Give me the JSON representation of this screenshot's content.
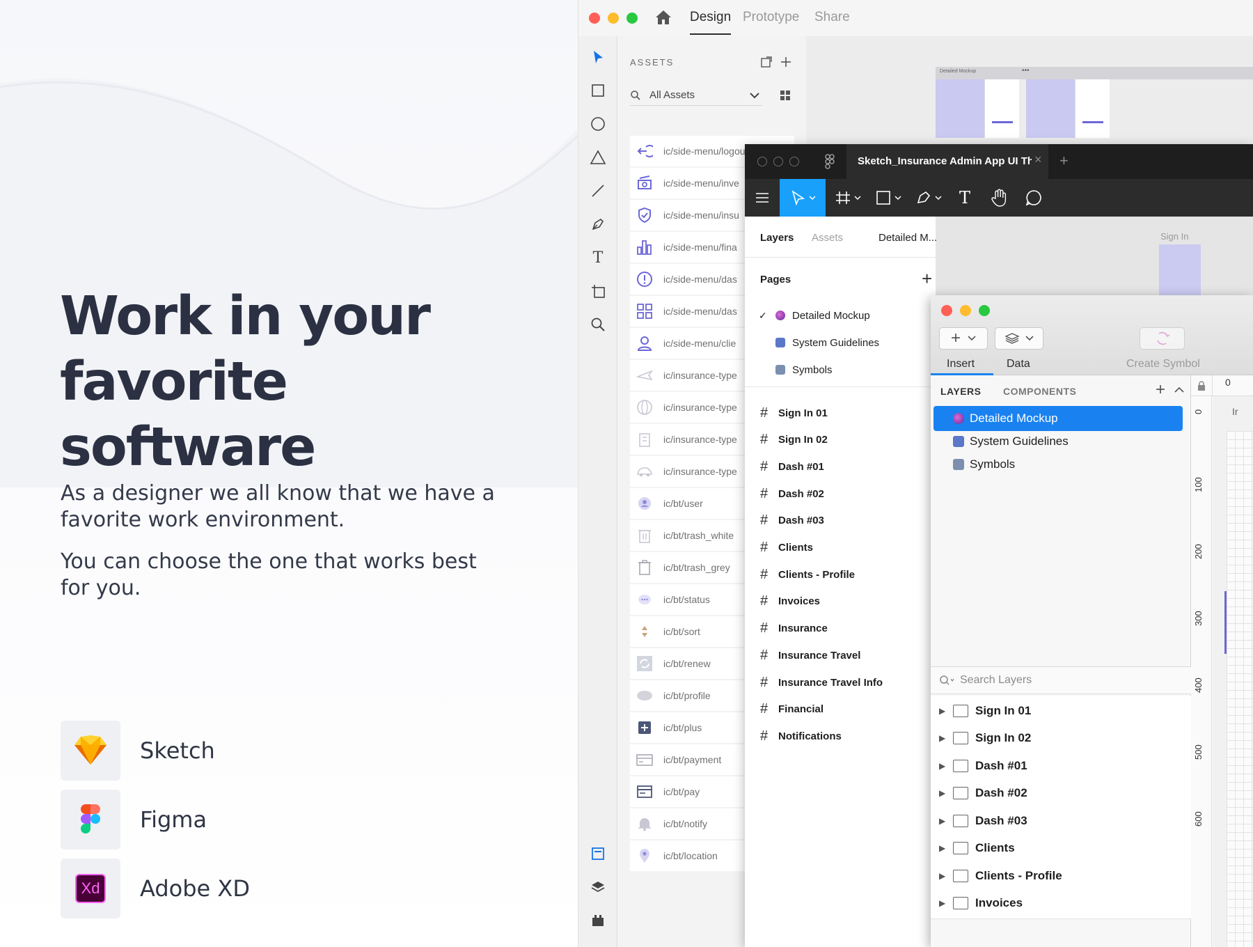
{
  "marketing": {
    "headline_line1": "Work in your",
    "headline_line2": "favorite software",
    "paragraph1": "As a designer we all know that we have a favorite work environment.",
    "paragraph2": "You can choose the one that works best for you.",
    "apps": [
      {
        "name": "Sketch",
        "icon": "sketch-diamond-icon"
      },
      {
        "name": "Figma",
        "icon": "figma-logo-icon"
      },
      {
        "name": "Adobe XD",
        "icon": "adobe-xd-logo-icon",
        "logo_text": "Xd"
      }
    ]
  },
  "xd": {
    "tabs": [
      "Design",
      "Prototype",
      "Share"
    ],
    "active_tab": "Design",
    "assets_title": "ASSETS",
    "filter_label": "All Assets",
    "assets": [
      {
        "label": "ic/side-menu/logout",
        "icon": "logout-icon"
      },
      {
        "label": "ic/side-menu/inve",
        "icon": "money-icon"
      },
      {
        "label": "ic/side-menu/insu",
        "icon": "shield-icon"
      },
      {
        "label": "ic/side-menu/fina",
        "icon": "bar-chart-icon"
      },
      {
        "label": "ic/side-menu/das",
        "icon": "alert-circle-icon"
      },
      {
        "label": "ic/side-menu/das",
        "icon": "grid-icon"
      },
      {
        "label": "ic/side-menu/clie",
        "icon": "user-icon"
      },
      {
        "label": "ic/insurance-type",
        "icon": "plane-icon"
      },
      {
        "label": "ic/insurance-type",
        "icon": "globe-icon"
      },
      {
        "label": "ic/insurance-type",
        "icon": "building-icon"
      },
      {
        "label": "ic/insurance-type",
        "icon": "car-icon"
      },
      {
        "label": "ic/bt/user",
        "icon": "user-circle-icon"
      },
      {
        "label": "ic/bt/trash_white",
        "icon": "trash-white-icon"
      },
      {
        "label": "ic/bt/trash_grey",
        "icon": "trash-grey-icon"
      },
      {
        "label": "ic/bt/status",
        "icon": "chat-bubble-icon"
      },
      {
        "label": "ic/bt/sort",
        "icon": "sort-icon"
      },
      {
        "label": "ic/bt/renew",
        "icon": "renew-icon"
      },
      {
        "label": "ic/bt/profile",
        "icon": "profile-oval-icon"
      },
      {
        "label": "ic/bt/plus",
        "icon": "plus-square-icon"
      },
      {
        "label": "ic/bt/payment",
        "icon": "card-icon"
      },
      {
        "label": "ic/bt/pay",
        "icon": "pay-card-icon"
      },
      {
        "label": "ic/bt/notify",
        "icon": "bell-icon"
      },
      {
        "label": "ic/bt/location",
        "icon": "location-pin-icon"
      }
    ],
    "canvas_artboard_label": "Detailed Mockup"
  },
  "figma": {
    "file_title": "Sketch_Insurance Admin App UI The...",
    "tabs": [
      "Layers",
      "Assets"
    ],
    "active_tab": "Layers",
    "current_page": "Detailed M...",
    "pages_title": "Pages",
    "pages": [
      "Detailed Mockup",
      "System Guidelines",
      "Symbols"
    ],
    "frames": [
      "Sign In 01",
      "Sign In 02",
      "Dash #01",
      "Dash #02",
      "Dash #03",
      "Clients",
      "Clients - Profile",
      "Invoices",
      "Insurance",
      "Insurance Travel",
      "Insurance Travel Info",
      "Financial",
      "Notifications"
    ],
    "canvas_label": "Sign In"
  },
  "sketch": {
    "toolbar": {
      "insert": "Insert",
      "data": "Data",
      "create_symbol": "Create Symbol"
    },
    "tabs": [
      "LAYERS",
      "COMPONENTS"
    ],
    "pages": [
      "Detailed Mockup",
      "System Guidelines",
      "Symbols"
    ],
    "selected_page": "Detailed Mockup",
    "search_placeholder": "Search Layers",
    "layers": [
      "Sign In 01",
      "Sign In 02",
      "Dash #01",
      "Dash #02",
      "Dash #03",
      "Clients",
      "Clients - Profile",
      "Invoices"
    ],
    "ruler_top": "0",
    "ruler_top_partial": "Ir",
    "ruler_marks": [
      "0",
      "100",
      "200",
      "300",
      "400",
      "500",
      "600"
    ]
  },
  "colors": {
    "xd_accent": "#1473e6",
    "figma_accent": "#18a0fb",
    "sketch_selection": "#1a82f0",
    "asset_purple": "#6c67d6",
    "xd_logo_bg": "#470137",
    "xd_logo_fg": "#ff61f6"
  }
}
